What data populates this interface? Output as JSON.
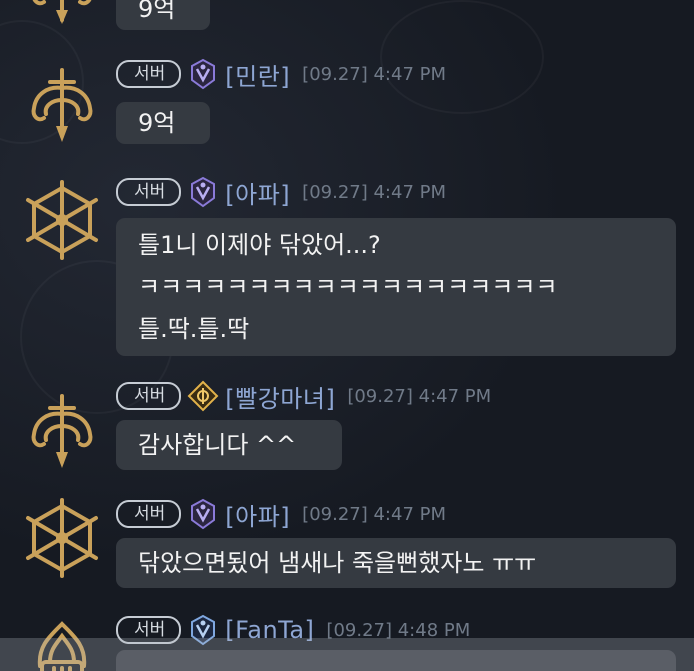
{
  "colors": {
    "background": "#161a22",
    "bubble": "#353a41",
    "name": "#8ea6d3",
    "timestamp": "#707a88",
    "avatar_gold": "#c9a15a",
    "icon_purple": "#8a7ad8",
    "icon_gold": "#e2b24a",
    "icon_blue": "#7fa7e0"
  },
  "chat": {
    "top_partial": {
      "avatar_icon": "dagger-emblem-icon",
      "lines": [
        "9억"
      ]
    },
    "messages": [
      {
        "server_label": "서버",
        "class_icon": "purple-crest-icon",
        "name": "[민란]",
        "time": "[09.27] 4:47 PM",
        "avatar_icon": "dagger-emblem-icon",
        "lines": [
          "9억"
        ]
      },
      {
        "server_label": "서버",
        "class_icon": "purple-crest-icon",
        "name": "[아파]",
        "time": "[09.27] 4:47 PM",
        "avatar_icon": "star-swords-emblem-icon",
        "lines": [
          "틀1니 이제야 닦았어...?",
          "ㅋㅋㅋㅋㅋㅋㅋㅋㅋㅋㅋㅋㅋㅋㅋㅋㅋㅋㅋ",
          "틀.딱.틀.딱"
        ]
      },
      {
        "server_label": "서버",
        "class_icon": "gold-diamond-icon",
        "name": "[빨강마녀]",
        "time": "[09.27] 4:47 PM",
        "avatar_icon": "dagger-emblem-icon",
        "lines": [
          "감사합니다 ^^"
        ]
      },
      {
        "server_label": "서버",
        "class_icon": "purple-crest-icon",
        "name": "[아파]",
        "time": "[09.27] 4:47 PM",
        "avatar_icon": "star-swords-emblem-icon",
        "lines": [
          "닦았으면됬어 냄새나 죽을뻔했자노 ㅠㅠ"
        ]
      },
      {
        "server_label": "서버",
        "class_icon": "blue-crest-icon",
        "name": "[FanTa]",
        "time": "[09.27] 4:48 PM",
        "avatar_icon": "flame-emblem-icon",
        "lines": []
      }
    ]
  }
}
